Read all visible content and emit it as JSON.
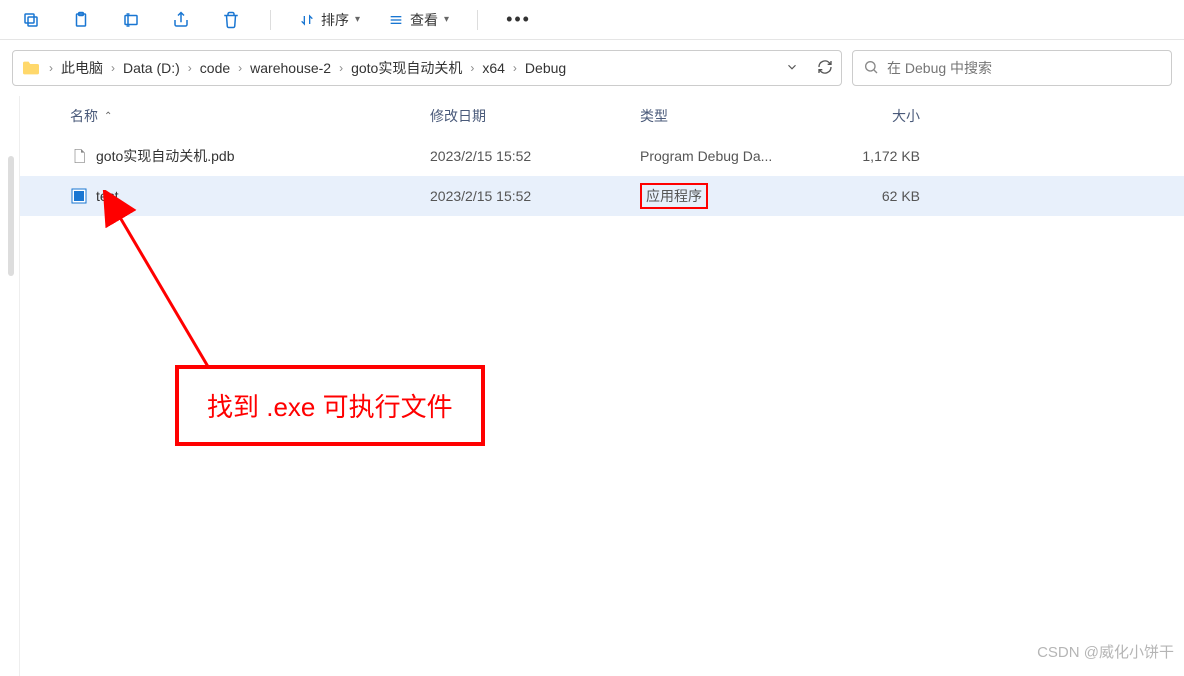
{
  "toolbar": {
    "sort_label": "排序",
    "view_label": "查看"
  },
  "breadcrumb": {
    "items": [
      "此电脑",
      "Data (D:)",
      "code",
      "warehouse-2",
      "goto实现自动关机",
      "x64",
      "Debug"
    ]
  },
  "search": {
    "placeholder": "在 Debug 中搜索"
  },
  "columns": {
    "name": "名称",
    "date": "修改日期",
    "type": "类型",
    "size": "大小"
  },
  "files": [
    {
      "name": "goto实现自动关机.pdb",
      "date": "2023/2/15 15:52",
      "type": "Program Debug Da...",
      "size": "1,172 KB",
      "icon": "pdb",
      "selected": false,
      "type_highlighted": false
    },
    {
      "name": "test",
      "date": "2023/2/15 15:52",
      "type": "应用程序",
      "size": "62 KB",
      "icon": "exe",
      "selected": true,
      "type_highlighted": true
    }
  ],
  "annotation": {
    "text": "找到 .exe 可执行文件"
  },
  "watermark": "CSDN @威化小饼干"
}
